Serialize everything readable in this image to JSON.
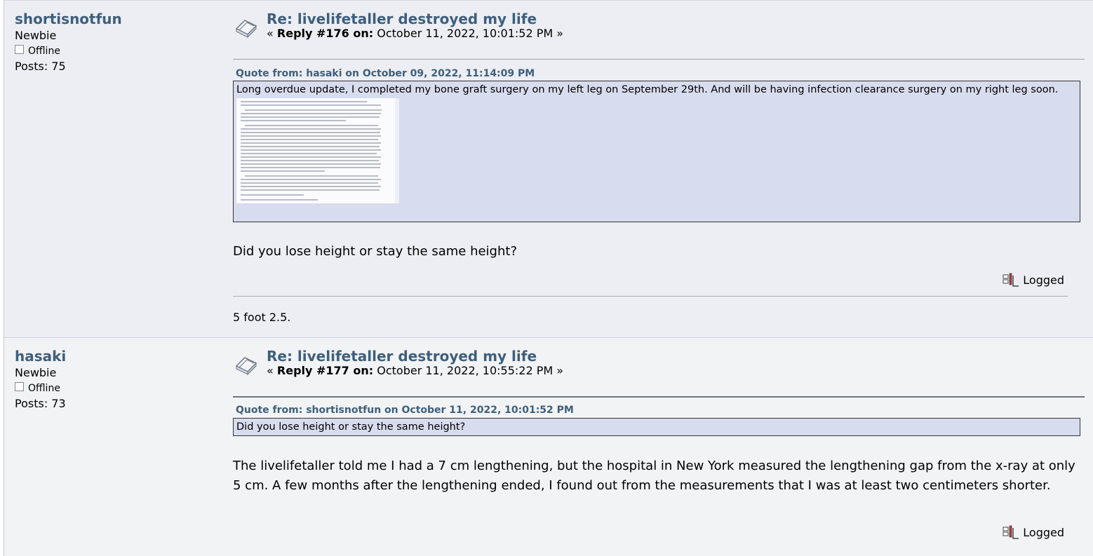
{
  "posts": [
    {
      "username": "shortisnotfun",
      "rank": "Newbie",
      "status": "Offline",
      "posts_count": "Posts: 75",
      "subject": "Re: livelifetaller destroyed my life",
      "reply_prefix": "«",
      "reply_label": "Reply #176 on:",
      "reply_date": "October 11, 2022, 10:01:52 PM »",
      "quote_header": "Quote from: hasaki on October 09, 2022, 11:14:09 PM",
      "quote_text": "Long overdue update, I completed my bone graft surgery on my left leg on September 29th. And will be having infection clearance surgery on my right leg soon.",
      "body": "Did you lose height or stay the same height?",
      "logged": "Logged",
      "signature": "5 foot 2.5."
    },
    {
      "username": "hasaki",
      "rank": "Newbie",
      "status": "Offline",
      "posts_count": "Posts: 73",
      "subject": "Re: livelifetaller destroyed my life",
      "reply_prefix": "«",
      "reply_label": "Reply #177 on:",
      "reply_date": "October 11, 2022, 10:55:22 PM »",
      "quote_header": "Quote from: shortisnotfun on October 11, 2022, 10:01:52 PM",
      "quote_text": "Did you lose height or stay the same height?",
      "body": "The livelifetaller told me I had a 7 cm lengthening, but the hospital in New York measured the lengthening gap from the x-ray at only 5 cm. A few months after the lengthening ended, I found out from the measurements that I was at least two centimeters shorter.",
      "logged": "Logged"
    }
  ],
  "colors": {
    "link": "#3e5f7d",
    "quote_bg": "#d7dcee",
    "post1_bg": "#eceef3",
    "post2_bg": "#f2f3f5"
  },
  "icons": [
    "message-icon",
    "offline-status-icon",
    "logged-ip-icon",
    "document-thumbnail"
  ]
}
